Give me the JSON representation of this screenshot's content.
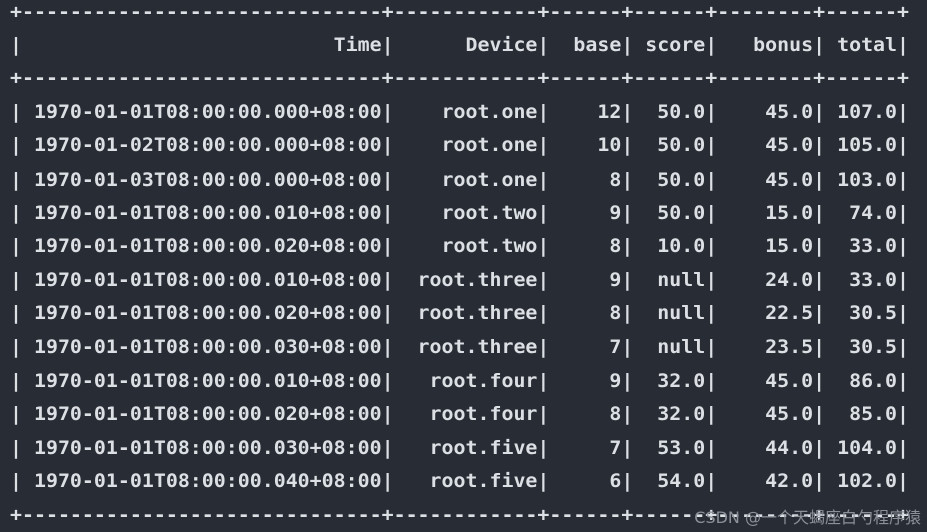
{
  "table": {
    "border": "+------------------------------+------------+------+------+--------+------+",
    "header_cells": [
      "Time",
      "Device",
      "base",
      "score",
      "bonus",
      "total"
    ],
    "rows": [
      [
        "1970-01-01T08:00:00.000+08:00",
        "root.one",
        "12",
        "50.0",
        "45.0",
        "107.0"
      ],
      [
        "1970-01-02T08:00:00.000+08:00",
        "root.one",
        "10",
        "50.0",
        "45.0",
        "105.0"
      ],
      [
        "1970-01-03T08:00:00.000+08:00",
        "root.one",
        "8",
        "50.0",
        "45.0",
        "103.0"
      ],
      [
        "1970-01-01T08:00:00.010+08:00",
        "root.two",
        "9",
        "50.0",
        "15.0",
        "74.0"
      ],
      [
        "1970-01-01T08:00:00.020+08:00",
        "root.two",
        "8",
        "10.0",
        "15.0",
        "33.0"
      ],
      [
        "1970-01-01T08:00:00.010+08:00",
        "root.three",
        "9",
        "null",
        "24.0",
        "33.0"
      ],
      [
        "1970-01-01T08:00:00.020+08:00",
        "root.three",
        "8",
        "null",
        "22.5",
        "30.5"
      ],
      [
        "1970-01-01T08:00:00.030+08:00",
        "root.three",
        "7",
        "null",
        "23.5",
        "30.5"
      ],
      [
        "1970-01-01T08:00:00.010+08:00",
        "root.four",
        "9",
        "32.0",
        "45.0",
        "86.0"
      ],
      [
        "1970-01-01T08:00:00.020+08:00",
        "root.four",
        "8",
        "32.0",
        "45.0",
        "85.0"
      ],
      [
        "1970-01-01T08:00:00.030+08:00",
        "root.five",
        "7",
        "53.0",
        "44.0",
        "104.0"
      ],
      [
        "1970-01-01T08:00:00.040+08:00",
        "root.five",
        "6",
        "54.0",
        "42.0",
        "102.0"
      ]
    ]
  },
  "watermark": "CSDN @一个天蝎座白勺程序猿",
  "colors": {
    "background": "#282c34",
    "text": "#dcdfe4"
  }
}
